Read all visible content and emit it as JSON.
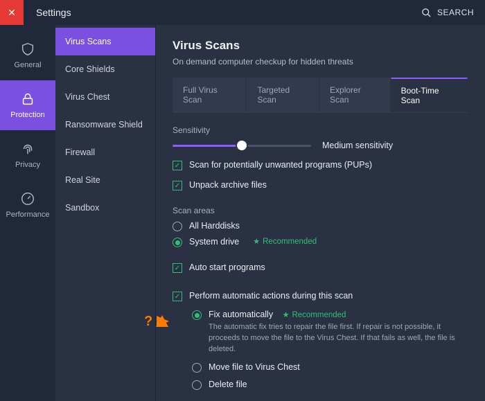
{
  "topbar": {
    "title": "Settings",
    "search": "SEARCH"
  },
  "rail": {
    "general": "General",
    "protection": "Protection",
    "privacy": "Privacy",
    "performance": "Performance"
  },
  "sidebar": {
    "items": [
      "Virus Scans",
      "Core Shields",
      "Virus Chest",
      "Ransomware Shield",
      "Firewall",
      "Real Site",
      "Sandbox"
    ]
  },
  "page": {
    "title": "Virus Scans",
    "subtitle": "On demand computer checkup for hidden threats"
  },
  "tabs": {
    "full": "Full Virus Scan",
    "targeted": "Targeted Scan",
    "explorer": "Explorer Scan",
    "boot": "Boot-Time Scan"
  },
  "sens": {
    "label": "Sensitivity",
    "value": "Medium sensitivity"
  },
  "checks": {
    "pups": "Scan for potentially unwanted programs (PUPs)",
    "unpack": "Unpack archive files",
    "autostart": "Auto start programs",
    "autoaction": "Perform automatic actions during this scan"
  },
  "scanareas": {
    "label": "Scan areas",
    "all": "All Harddisks",
    "system": "System drive",
    "reco": "Recommended"
  },
  "actions": {
    "fix": "Fix automatically",
    "reco": "Recommended",
    "desc": "The automatic fix tries to repair the file first. If repair is not possible, it proceeds to move the file to the Virus Chest. If that fails as well, the file is deleted.",
    "move": "Move file to Virus Chest",
    "delete": "Delete file"
  },
  "pointer": "?"
}
